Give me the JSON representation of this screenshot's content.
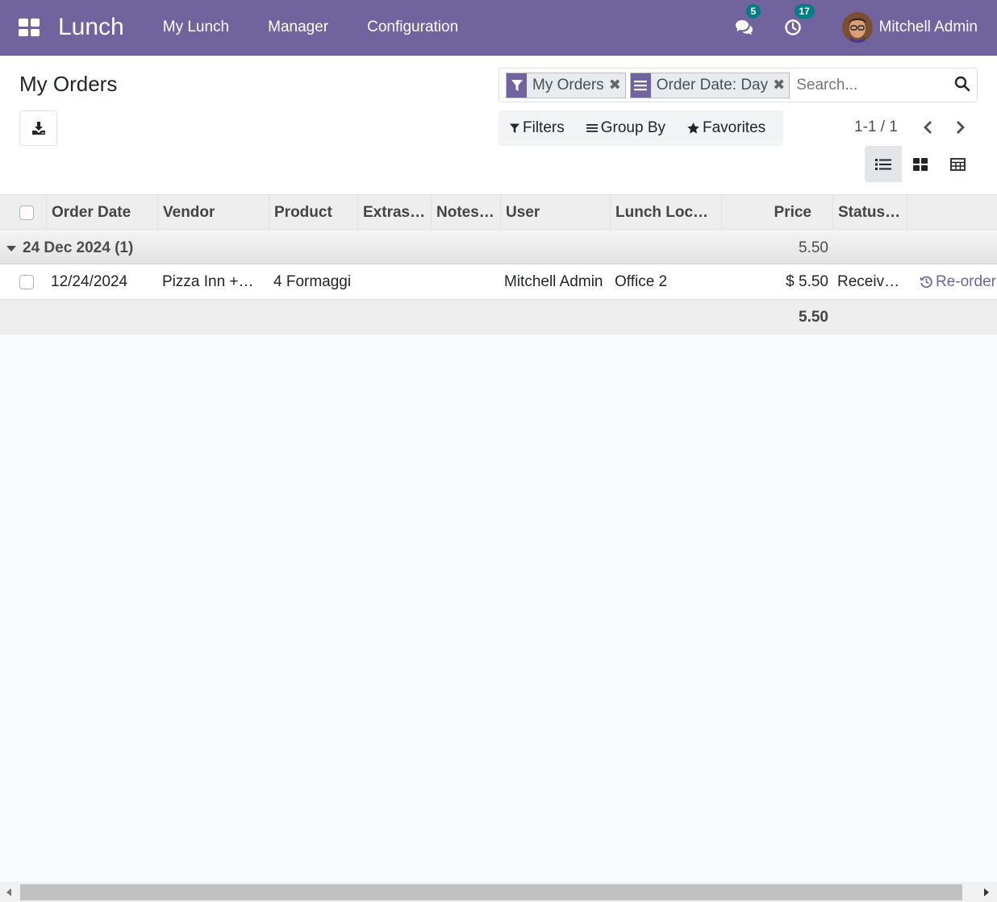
{
  "navbar": {
    "app_name": "Lunch",
    "menu": [
      {
        "label": "My Lunch"
      },
      {
        "label": "Manager"
      },
      {
        "label": "Configuration"
      }
    ],
    "messages_count": "5",
    "activities_count": "17",
    "user_name": "Mitchell Admin"
  },
  "control_panel": {
    "title": "My Orders",
    "search": {
      "facets": [
        {
          "label": "My Orders",
          "icon": "filter-icon"
        },
        {
          "label": "Order Date: Day",
          "icon": "group-by-icon"
        }
      ],
      "placeholder": "Search..."
    },
    "filters_label": "Filters",
    "group_by_label": "Group By",
    "favorites_label": "Favorites",
    "pager": "1-1 / 1",
    "views": [
      "list-view",
      "kanban-view",
      "pivot-view"
    ],
    "active_view": "list-view"
  },
  "table": {
    "columns": [
      "Order Date",
      "Vendor",
      "Product",
      "Extras…",
      "Notes…",
      "User",
      "Lunch Loc…",
      "Price",
      "Status…"
    ],
    "groups": [
      {
        "label": "24 Dec 2024 (1)",
        "total": "5.50",
        "rows": [
          {
            "order_date": "12/24/2024",
            "vendor": "Pizza Inn +…",
            "product": "4 Formaggi",
            "extras": "",
            "notes": "",
            "user": "Mitchell Admin",
            "location": "Office 2",
            "price": "$ 5.50",
            "status": "Receiv…",
            "action": "Re-order"
          }
        ]
      }
    ],
    "footer_total": "5.50"
  },
  "colors": {
    "brand": "#71639e",
    "badge": "#017e84"
  }
}
